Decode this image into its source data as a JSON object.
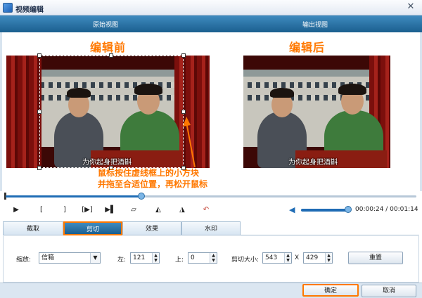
{
  "window": {
    "title": "视频编辑",
    "close_glyph": "✕"
  },
  "view_bar": {
    "left_label": "原始视图",
    "right_label": "输出视图"
  },
  "preview": {
    "before_title": "编辑前",
    "after_title": "编辑后",
    "subtitle": "为你起身把酒斟",
    "note_line1": "鼠标按住虚线框上的小方块",
    "note_line2": "并拖至合适位置，再松开鼠标",
    "accent_color": "#ff7800"
  },
  "seek": {
    "progress": 0.33
  },
  "controls": {
    "play": "▶",
    "mark_in": "[",
    "mark_out": "]",
    "play_range": "[▶]",
    "step": "▶▌",
    "flip_v": "⏥",
    "rotate_left": "◭",
    "rotate_right": "◮",
    "undo": "↶",
    "volume_level": 1.0,
    "time": "00:00:24 / 00:01:14"
  },
  "tabs": [
    {
      "label": "截取"
    },
    {
      "label": "剪切"
    },
    {
      "label": "效果"
    },
    {
      "label": "水印"
    }
  ],
  "settings": {
    "zoom_label": "缩放:",
    "zoom_value": "信箱",
    "left_label": "左:",
    "left_value": "121",
    "top_label": "上:",
    "top_value": "0",
    "size_label": "剪切大小:",
    "width_value": "543",
    "x_label": "X",
    "height_value": "429",
    "reset_label": "重置"
  },
  "footer": {
    "ok_label": "确定",
    "cancel_label": "取消"
  }
}
